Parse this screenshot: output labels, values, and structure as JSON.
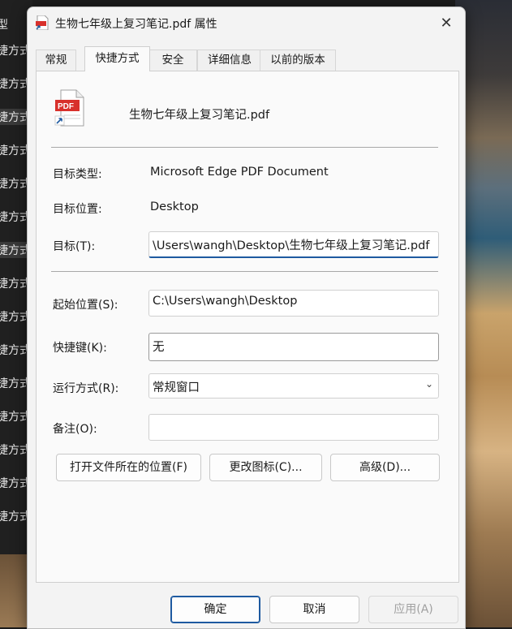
{
  "background": {
    "sidebar_rows": [
      "型",
      "捷方式",
      "捷方式",
      "捷方式",
      "捷方式",
      "捷方式",
      "捷方式",
      "捷方式",
      "捷方式",
      "捷方式",
      "捷方式",
      "捷方式",
      "捷方式",
      "捷方式",
      "捷方式",
      "捷方式"
    ]
  },
  "dialog": {
    "title": "生物七年级上复习笔记.pdf 属性",
    "close_glyph": "✕",
    "tabs": [
      {
        "label": "常规"
      },
      {
        "label": "快捷方式"
      },
      {
        "label": "安全"
      },
      {
        "label": "详细信息"
      },
      {
        "label": "以前的版本"
      }
    ],
    "active_tab": "快捷方式",
    "file_name": "生物七年级上复习笔记.pdf",
    "target_type_label": "目标类型:",
    "target_type_value": "Microsoft Edge PDF Document",
    "target_location_label": "目标位置:",
    "target_location_value": "Desktop",
    "target_label": "目标(T):",
    "target_value": "\\Users\\wangh\\Desktop\\生物七年级上复习笔记.pdf",
    "start_in_label": "起始位置(S):",
    "start_in_value": "C:\\Users\\wangh\\Desktop",
    "shortcut_key_label": "快捷键(K):",
    "shortcut_key_value": "无",
    "run_label": "运行方式(R):",
    "run_value": "常规窗口",
    "comment_label": "备注(O):",
    "comment_value": "",
    "open_location_button": "打开文件所在的位置(F)",
    "change_icon_button": "更改图标(C)...",
    "advanced_button": "高级(D)...",
    "ok_button": "确定",
    "cancel_button": "取消",
    "apply_button": "应用(A)"
  },
  "colors": {
    "accent": "#1e5aa0",
    "pdf_red": "#d8302b"
  }
}
